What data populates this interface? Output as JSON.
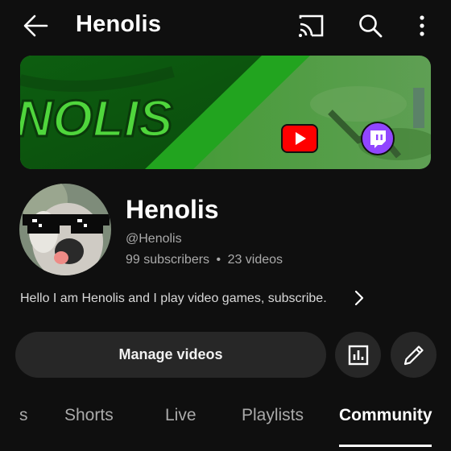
{
  "header": {
    "title": "Henolis",
    "back_icon": "arrow-left-icon",
    "cast_icon": "cast-icon",
    "search_icon": "search-icon",
    "more_icon": "more-vert-icon"
  },
  "banner": {
    "text": "NOLIS",
    "logos": [
      "youtube-logo",
      "twitch-logo"
    ]
  },
  "channel": {
    "name": "Henolis",
    "handle": "@Henolis",
    "subscribers": "99 subscribers",
    "separator": "•",
    "videos": "23 videos",
    "description": "Hello I am Henolis and I play video games,  subscribe."
  },
  "actions": {
    "manage_label": "Manage videos",
    "analytics_icon": "analytics-icon",
    "edit_icon": "pencil-icon"
  },
  "tabs": [
    {
      "label": "s"
    },
    {
      "label": "Shorts"
    },
    {
      "label": "Live"
    },
    {
      "label": "Playlists"
    },
    {
      "label": "Community",
      "active": true
    }
  ],
  "colors": {
    "background": "#0f0f0f",
    "button_bg": "#272727",
    "secondary_text": "#aaaaaa",
    "youtube_red": "#ff0000",
    "twitch_purple": "#9146ff",
    "banner_green": "#1e8a1e"
  }
}
